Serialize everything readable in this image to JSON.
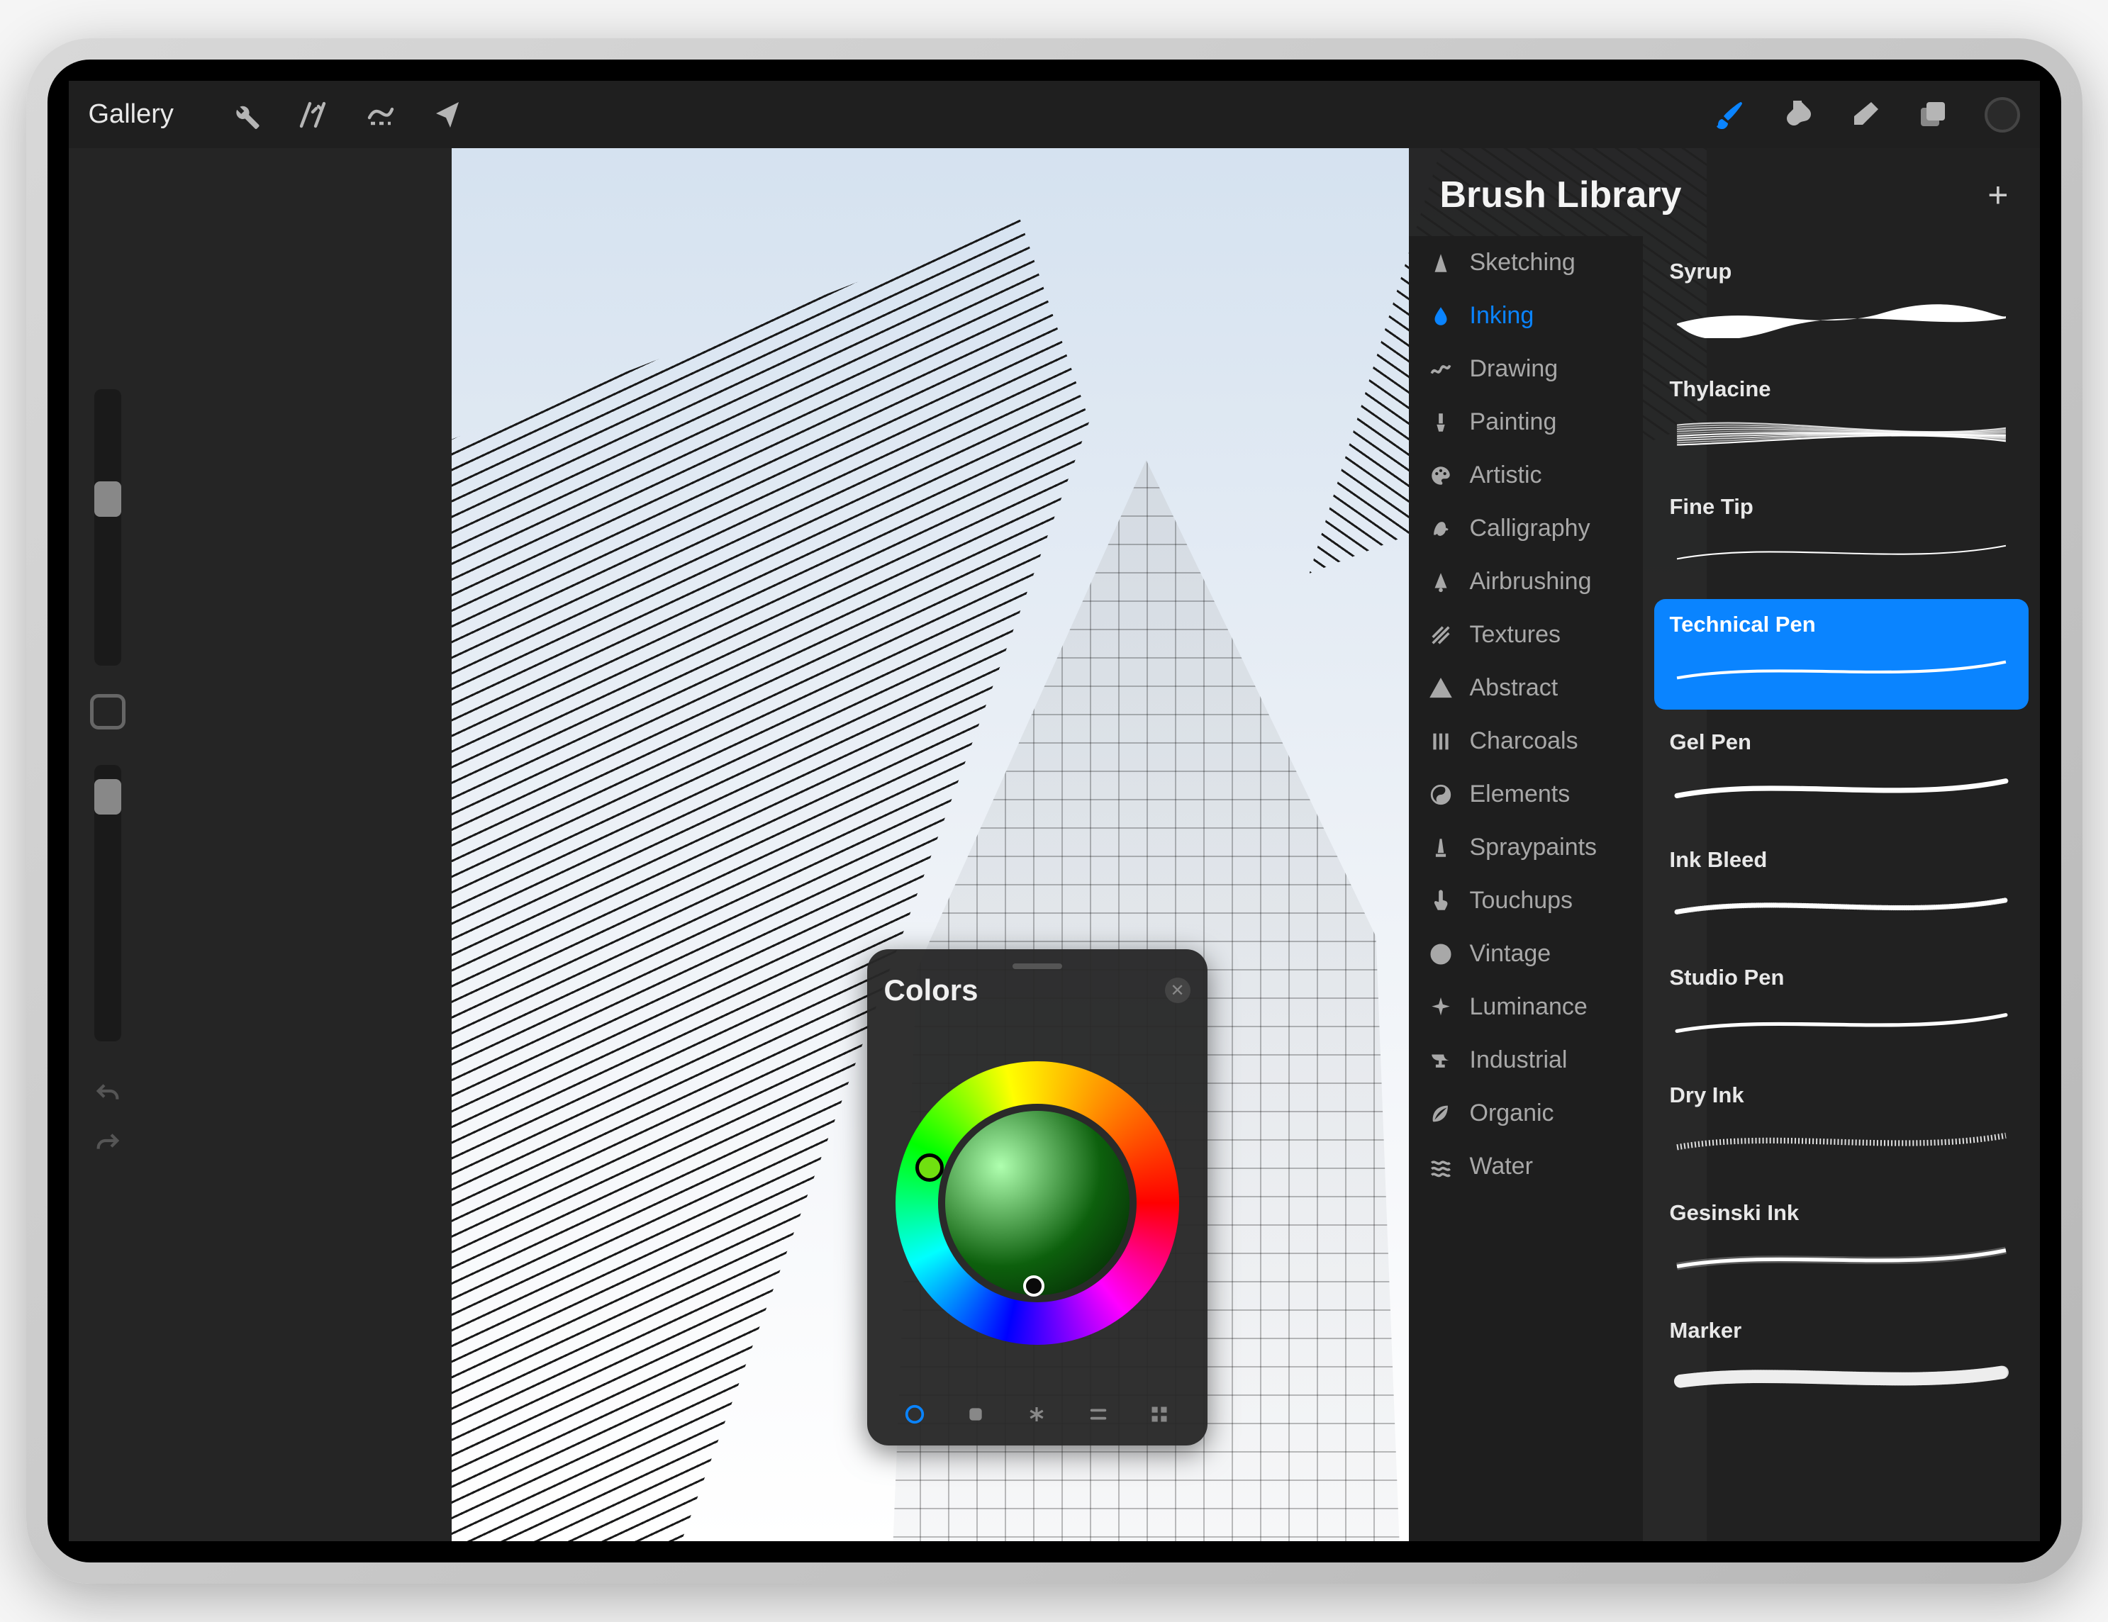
{
  "toolbar": {
    "gallery_label": "Gallery"
  },
  "colors_panel": {
    "title": "Colors"
  },
  "brush_panel": {
    "title": "Brush Library",
    "categories": [
      {
        "icon": "pencil",
        "label": "Sketching",
        "active": false
      },
      {
        "icon": "drop",
        "label": "Inking",
        "active": true
      },
      {
        "icon": "squiggle",
        "label": "Drawing",
        "active": false
      },
      {
        "icon": "brush",
        "label": "Painting",
        "active": false
      },
      {
        "icon": "palette",
        "label": "Artistic",
        "active": false
      },
      {
        "icon": "script-a",
        "label": "Calligraphy",
        "active": false
      },
      {
        "icon": "spray-can",
        "label": "Airbrushing",
        "active": false
      },
      {
        "icon": "diag",
        "label": "Textures",
        "active": false
      },
      {
        "icon": "triangle",
        "label": "Abstract",
        "active": false
      },
      {
        "icon": "lines",
        "label": "Charcoals",
        "active": false
      },
      {
        "icon": "yinyang",
        "label": "Elements",
        "active": false
      },
      {
        "icon": "monument",
        "label": "Spraypaints",
        "active": false
      },
      {
        "icon": "finger",
        "label": "Touchups",
        "active": false
      },
      {
        "icon": "clock",
        "label": "Vintage",
        "active": false
      },
      {
        "icon": "sparkle",
        "label": "Luminance",
        "active": false
      },
      {
        "icon": "anvil",
        "label": "Industrial",
        "active": false
      },
      {
        "icon": "leaf",
        "label": "Organic",
        "active": false
      },
      {
        "icon": "waves",
        "label": "Water",
        "active": false
      }
    ],
    "brushes": [
      {
        "name": "Syrup",
        "selected": false,
        "style": "syrup"
      },
      {
        "name": "Thylacine",
        "selected": false,
        "style": "thylacine"
      },
      {
        "name": "Fine Tip",
        "selected": false,
        "style": "finetip"
      },
      {
        "name": "Technical Pen",
        "selected": true,
        "style": "technical"
      },
      {
        "name": "Gel Pen",
        "selected": false,
        "style": "gel"
      },
      {
        "name": "Ink Bleed",
        "selected": false,
        "style": "inkbleed"
      },
      {
        "name": "Studio Pen",
        "selected": false,
        "style": "studio"
      },
      {
        "name": "Dry Ink",
        "selected": false,
        "style": "dryink"
      },
      {
        "name": "Gesinski Ink",
        "selected": false,
        "style": "gesinski"
      },
      {
        "name": "Marker",
        "selected": false,
        "style": "marker"
      }
    ]
  }
}
